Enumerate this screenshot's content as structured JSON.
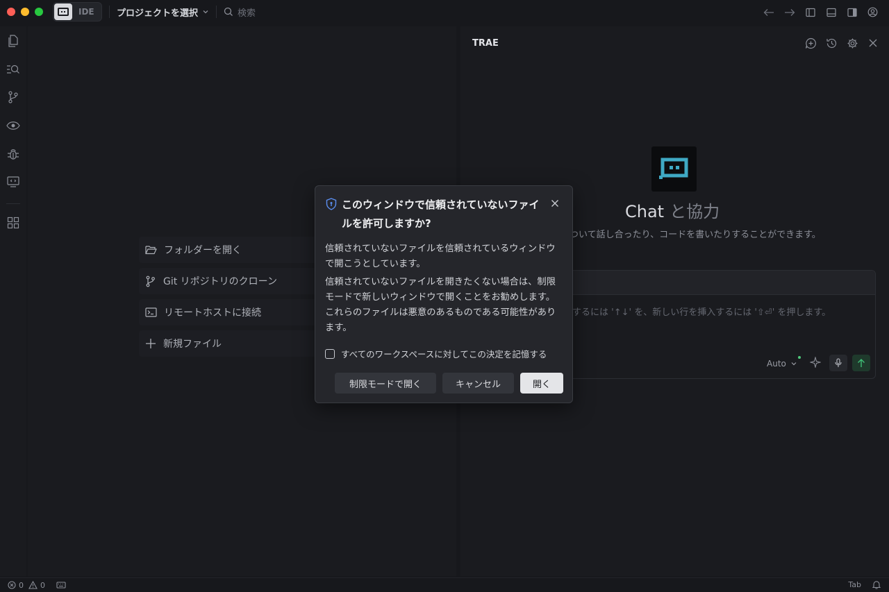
{
  "app": {
    "badge_label": "IDE",
    "project_select": "プロジェクトを選択",
    "search_placeholder": "検索"
  },
  "activity_bar": {
    "items": [
      "explorer-icon",
      "search-icon",
      "source-control-icon",
      "preview-icon",
      "debug-icon",
      "remote-icon",
      "extensions-icon"
    ]
  },
  "editor": {
    "start_items": [
      {
        "icon": "folder-open-icon",
        "label": "フォルダーを開く"
      },
      {
        "icon": "git-branch-icon",
        "label": "Git リポジトリのクローン"
      },
      {
        "icon": "terminal-icon",
        "label": "リモートホストに接続"
      },
      {
        "icon": "plus-icon",
        "label": "新規ファイル"
      }
    ]
  },
  "chat": {
    "title": "TRAE",
    "heading_main": "Chat",
    "heading_sub": "と協力",
    "description": "ついて話し合ったり、コードを書いたりすることができます。",
    "input_placeholder": "するには '↑↓' を、新しい行を挿入するには '⇧⏎' を押します。",
    "model_label": "Auto"
  },
  "dialog": {
    "title": "このウィンドウで信頼されていないファイルを許可しますか?",
    "body_1": "信頼されていないファイルを信頼されているウィンドウで開こうとしています。",
    "body_2": "信頼されていないファイルを開きたくない場合は、制限モードで新しいウィンドウで開くことをお勧めします。これらのファイルは悪意のあるものである可能性があります。",
    "checkbox_label": "すべてのワークスペースに対してこの決定を記憶する",
    "btn_restricted": "制限モードで開く",
    "btn_cancel": "キャンセル",
    "btn_open": "開く"
  },
  "status": {
    "errors": "0",
    "warnings": "0",
    "tab_label": "Tab"
  },
  "colors": {
    "accent_cyan": "#3fa9c4",
    "background": "#17181c",
    "panel": "#1a1b1f",
    "dialog": "#25262b"
  }
}
